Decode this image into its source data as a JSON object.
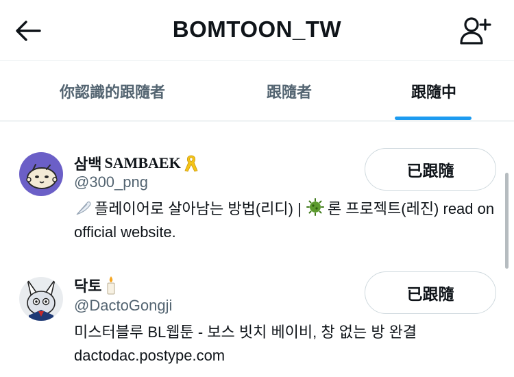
{
  "header": {
    "title": "BOMTOON_TW",
    "back_icon": "arrow-left-icon",
    "add_icon": "person-plus-icon"
  },
  "tabs": [
    {
      "label": "你認識的跟隨者",
      "active": false
    },
    {
      "label": "跟隨者",
      "active": false
    },
    {
      "label": "跟隨中",
      "active": true
    }
  ],
  "accent_color": "#1d9bf0",
  "users": [
    {
      "name_hangul": "삼백",
      "name_latin": "SAMBAEK",
      "name_emoji": "ribbon-icon",
      "handle": "@300_png",
      "bio_part1": "플레이어로 살아남는 방법(리디) | ",
      "bio_part2": "론 프로젝트(레진) read on official website.",
      "bio_icons": [
        "feather-icon",
        "virus-icon"
      ],
      "follow_label": "已跟隨"
    },
    {
      "name": "닥토",
      "name_emoji": "candle-icon",
      "handle": "@DactoGongji",
      "bio_line1": "미스터블루 BL웹툰 - 보스 빗치 베이비, 창 없는 방 완결",
      "bio_line2": "dactodac.postype.com",
      "follow_label": "已跟隨"
    }
  ]
}
